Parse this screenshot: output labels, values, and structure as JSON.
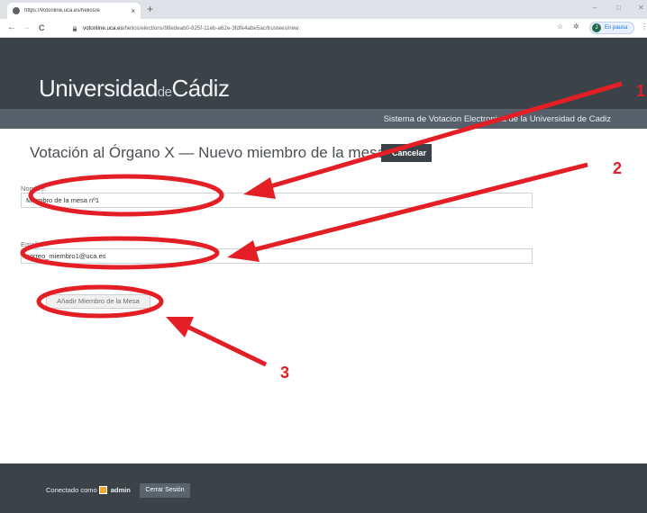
{
  "browser": {
    "tab_title": "https://votonline.uca.es/helios/e",
    "tab_close": "×",
    "new_tab": "+",
    "url_host": "votonline.uca.es",
    "url_path": "/helios/elections/98edeab0-825f-11eb-a62e-3fdfe4abe5ac/trustees/new",
    "profile_initial": "J",
    "profile_status": "En pausa",
    "win_minimize": "–",
    "win_maximize": "□",
    "win_close": "✕",
    "nav_back": "←",
    "nav_forward": "→",
    "nav_reload": "C",
    "star": "☆",
    "extensions": "✲",
    "menu": "⋮"
  },
  "site": {
    "logo_part1": "Universidad",
    "logo_part2": "de",
    "logo_part3": "Cádiz",
    "subheader": "Sistema de Votacion Electronica de la Universidad de Cadiz"
  },
  "page": {
    "title": "Votación al Órgano X — Nuevo miembro de la mesa",
    "cancel_label": "Cancelar"
  },
  "form": {
    "name_label": "Nombre:",
    "name_value": "Miembro de la mesa nº1",
    "email_label": "Email:",
    "email_value": "correo_miembro1@uca.es",
    "submit_label": "Añadir Miembro de la Mesa"
  },
  "annotations": {
    "color": "#e31e24",
    "num1": "1",
    "num2": "2",
    "num3": "3"
  },
  "footer": {
    "connected_as": "Conectado como",
    "user": "admin",
    "logout_label": "Cerrar Sesión"
  }
}
